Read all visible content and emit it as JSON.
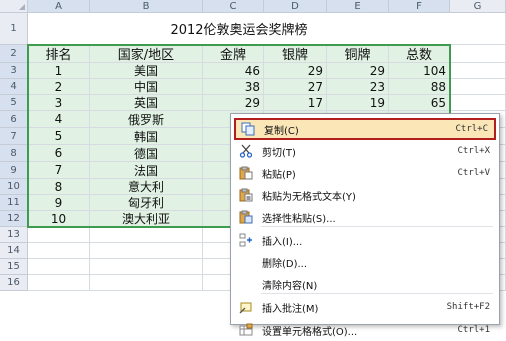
{
  "columns": [
    "A",
    "B",
    "C",
    "D",
    "E",
    "F",
    "G"
  ],
  "rows": [
    "1",
    "2",
    "3",
    "4",
    "5",
    "6",
    "7",
    "8",
    "9",
    "10",
    "11",
    "12",
    "13",
    "14",
    "15",
    "16"
  ],
  "sheet": {
    "title": "2012伦敦奥运会奖牌榜",
    "headers": [
      "排名",
      "国家/地区",
      "金牌",
      "银牌",
      "铜牌",
      "总数"
    ],
    "data_rows": [
      [
        "1",
        "美国",
        "46",
        "29",
        "29",
        "104"
      ],
      [
        "2",
        "中国",
        "38",
        "27",
        "23",
        "88"
      ],
      [
        "3",
        "英国",
        "29",
        "17",
        "19",
        "65"
      ],
      [
        "4",
        "俄罗斯",
        "",
        "",
        "",
        ""
      ],
      [
        "5",
        "韩国",
        "",
        "",
        "",
        ""
      ],
      [
        "6",
        "德国",
        "",
        "",
        "",
        ""
      ],
      [
        "7",
        "法国",
        "",
        "",
        "",
        ""
      ],
      [
        "8",
        "意大利",
        "",
        "",
        "",
        ""
      ],
      [
        "9",
        "匈牙利",
        "",
        "",
        "",
        ""
      ],
      [
        "10",
        "澳大利亚",
        "",
        "",
        "",
        ""
      ]
    ]
  },
  "context_menu": {
    "items": [
      {
        "icon": "copy-icon",
        "label": "复制(C)",
        "shortcut": "Ctrl+C",
        "highlighted": true
      },
      {
        "icon": "scissors-icon",
        "label": "剪切(T)",
        "shortcut": "Ctrl+X"
      },
      {
        "icon": "paste-icon",
        "label": "粘贴(P)",
        "shortcut": "Ctrl+V"
      },
      {
        "icon": "paste-text-icon",
        "label": "粘贴为无格式文本(Y)",
        "shortcut": ""
      },
      {
        "icon": "paste-special-icon",
        "label": "选择性粘贴(S)...",
        "shortcut": ""
      },
      {
        "icon": "insert-icon",
        "label": "插入(I)...",
        "shortcut": ""
      },
      {
        "icon": "",
        "label": "删除(D)...",
        "shortcut": ""
      },
      {
        "icon": "",
        "label": "清除内容(N)",
        "shortcut": ""
      },
      {
        "icon": "comment-icon",
        "label": "插入批注(M)",
        "shortcut": "Shift+F2"
      },
      {
        "icon": "format-cells-icon",
        "label": "设置单元格格式(O)...",
        "shortcut": "Ctrl+1"
      }
    ]
  },
  "colors": {
    "selection_border": "#3f9b50",
    "menu_highlight_bg": "#fbe6b8",
    "menu_highlight_border": "#b21e1e"
  }
}
